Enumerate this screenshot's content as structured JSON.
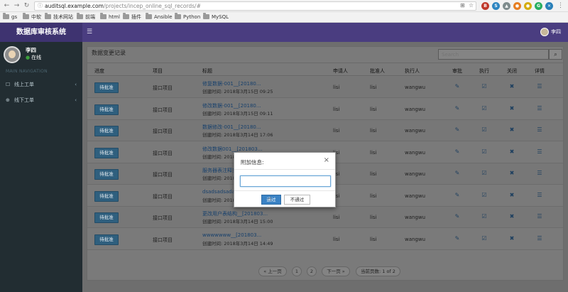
{
  "browser": {
    "url_host": "auditsql.example.com",
    "url_path": "/projects/incep_online_sql_records/#",
    "bookmarks": [
      "gs",
      "中软",
      "技术网站",
      "前端",
      "html",
      "插件",
      "Ansible",
      "Python",
      "MySQL"
    ]
  },
  "app": {
    "brand": "数据库审核系统",
    "menu_icon": "☰",
    "user_name": "李四"
  },
  "sidebar": {
    "user_name": "李四",
    "status": "在线",
    "section": "MAIN NAVIGATION",
    "items": [
      {
        "icon": "☐",
        "label": "线上工单"
      },
      {
        "icon": "⊕",
        "label": "线下工单"
      }
    ]
  },
  "panel": {
    "title": "数据变更记录",
    "search_placeholder": "Search",
    "search_icon": "⌕"
  },
  "table": {
    "headers": [
      "进度",
      "项目",
      "标题",
      "申请人",
      "批准人",
      "执行人",
      "审批",
      "执行",
      "关闭",
      "详情"
    ],
    "rows": [
      {
        "progress": "待批准",
        "project": "接口项目",
        "title": "修复数据-001__[20180...",
        "created": "创建时间: 2018年3月15日 09:25",
        "applicant": "lisi",
        "approver": "lisi",
        "executor": "wangwu"
      },
      {
        "progress": "待批准",
        "project": "接口项目",
        "title": "修改数据-001__[20180...",
        "created": "创建时间: 2018年3月15日 09:11",
        "applicant": "lisi",
        "approver": "lisi",
        "executor": "wangwu"
      },
      {
        "progress": "待批准",
        "project": "接口项目",
        "title": "数据修改-001__[20180...",
        "created": "创建时间: 2018年3月14日 17:06",
        "applicant": "lisi",
        "approver": "lisi",
        "executor": "wangwu"
      },
      {
        "progress": "待批准",
        "project": "接口项目",
        "title": "修改数据001__[201803...",
        "created": "创建时间: 2018年3月14日 16:50",
        "applicant": "lisi",
        "approver": "lisi",
        "executor": "wangwu"
      },
      {
        "progress": "待批准",
        "project": "接口项目",
        "title": "服务器表注释变更__[2018...",
        "created": "创建时间: 2018年3月14日 16:31",
        "applicant": "lisi",
        "approver": "lisi",
        "executor": "wangwu"
      },
      {
        "progress": "待批准",
        "project": "接口项目",
        "title": "dsadsadsada__[201803...",
        "created": "创建时间: 2018年3月14日 15:02",
        "applicant": "lisi",
        "approver": "lisi",
        "executor": "wangwu"
      },
      {
        "progress": "待批准",
        "project": "接口项目",
        "title": "更改用户表结构__[201803...",
        "created": "创建时间: 2018年3月14日 15:00",
        "applicant": "lisi",
        "approver": "lisi",
        "executor": "wangwu"
      },
      {
        "progress": "待批准",
        "project": "接口项目",
        "title": "wwwwwww__[201803...",
        "created": "创建时间: 2018年3月14日 14:49",
        "applicant": "lisi",
        "approver": "lisi",
        "executor": "wangwu"
      }
    ],
    "action_icons": {
      "approve": "✎",
      "execute": "☑",
      "close": "✖",
      "detail": "☰"
    }
  },
  "pagination": {
    "prev": "« 上一页",
    "page1": "1",
    "page2": "2",
    "next": "下一页 »",
    "status": "当前页数: 1 of 2"
  },
  "modal": {
    "title": "附加信息:",
    "close": "×",
    "input_value": "",
    "pass_label": "通过",
    "reject_label": "不通过"
  }
}
